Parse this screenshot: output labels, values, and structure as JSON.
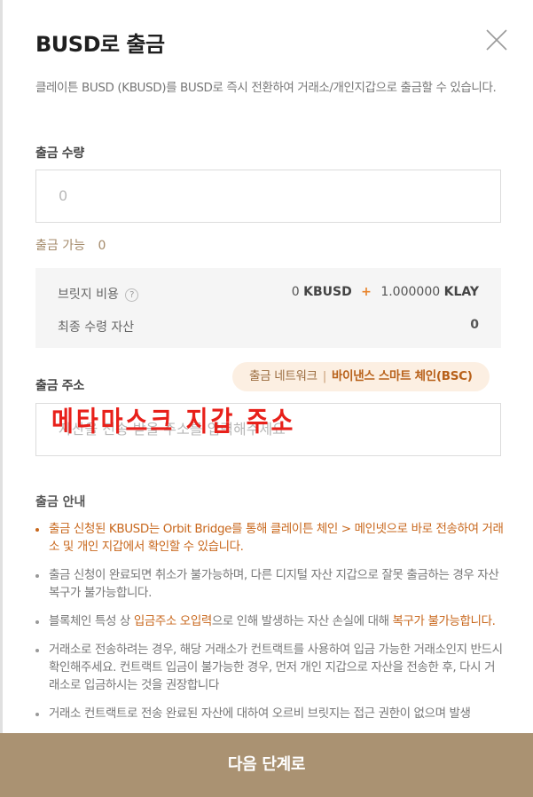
{
  "modal": {
    "title": "BUSD로 출금",
    "description": "클레이튼 BUSD (KBUSD)를 BUSD로 즉시 전환하여 거래소/개인지갑으로 출금할 수 있습니다."
  },
  "amount": {
    "label": "출금 수량",
    "placeholder": "0",
    "available_label": "출금 가능",
    "available_value": "0"
  },
  "fee": {
    "bridge_label": "브릿지 비용",
    "bridge_amount": "0",
    "bridge_unit": "KBUSD",
    "plus": "+",
    "klay_amount": "1.000000",
    "klay_unit": "KLAY",
    "final_label": "최종 수령 자산",
    "final_value": "0"
  },
  "address": {
    "label": "출금 주소",
    "network_label": "출금 네트워크",
    "network_separator": "|",
    "network_value": "바이낸스 스마트 체인(BSC)",
    "placeholder": "자산을 전송 받을 주소를 입력해주세요",
    "handwritten_note": "메타마스크 지갑 주소"
  },
  "guide": {
    "title": "출금 안내",
    "item1": "출금 신청된 KBUSD는 Orbit Bridge를 통해 클레이튼 체인 > 메인넷으로 바로 전송하여 거래소 및 개인 지갑에서 확인할 수 있습니다.",
    "item2": "출금 신청이 완료되면 취소가 불가능하며, 다른 디지털 자산 지갑으로 잘못 출금하는 경우 자산 복구가 불가능합니다.",
    "item3_a": "블록체인 특성 상 ",
    "item3_b": "입금주소 오입력",
    "item3_c": "으로 인해 발생하는 자산 손실에 대해 ",
    "item3_d": "복구가 불가능합니다.",
    "item4": "거래소로 전송하려는 경우, 해당 거래소가 컨트랙트를 사용하여 입금 가능한 거래소인지 반드시 확인해주세요. 컨트랙트 입금이 불가능한 경우, 먼저 개인 지갑으로 자산을 전송한 후, 다시 거래소로 입금하시는 것을 권장합니다",
    "item5": "거래소 컨트랙트로 전송 완료된 자산에 대하여 오르비 브릿지는 접근 권한이 없으며 발생"
  },
  "footer": {
    "next_label": "다음 단계로"
  },
  "colors": {
    "accent": "#aa9272",
    "highlight": "#c8671c",
    "handwriting": "#e8201a"
  }
}
